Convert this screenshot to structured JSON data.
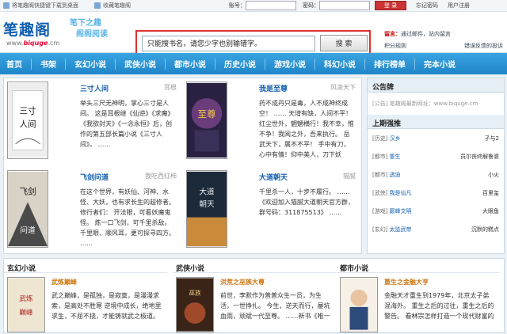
{
  "topbar": {
    "shortcut": "将笔趣阁快捷键下载到桌面",
    "bookmark": "收藏笔趣阁",
    "account_label": "账号：",
    "password_label": "密码：",
    "login_button": "登 录",
    "forgot": "忘记密码",
    "register": "用户注册"
  },
  "logo": {
    "cn": "笔趣阁",
    "en_prefix": "www.",
    "en_main": "biquge",
    "en_suffix": ".cm"
  },
  "slogan": {
    "line1": "笔下之趣",
    "line2": "阁阁阅读"
  },
  "search": {
    "value": "只能搜书名，请您少字也别输错字。",
    "button": "搜 索"
  },
  "notice": {
    "r1_label": "留言：",
    "r1_text": "通过邮件，站内留言",
    "r2_a": "积分规则",
    "r2_b": "错误反馈的投诉"
  },
  "nav": [
    "首页",
    "书架",
    "玄幻小说",
    "武侠小说",
    "都市小说",
    "历史小说",
    "游戏小说",
    "科幻小说",
    "排行榜单",
    "完本小说"
  ],
  "books": [
    {
      "title": "三寸人间",
      "author": "耳根",
      "desc": "举头三尺无神明，掌心三寸是人间。 这是耳根继《仙逆》《求魔》《我欲封天》《一念永恒》后，创作的第五部长篇小说《三寸人间》。 ……"
    },
    {
      "title": "我是至尊",
      "author": "风凌天下",
      "desc": "药不成丹只是毒，人不成神终成空！ …… 天增有缺，人间不平！红尘世外，魍魉横行！我不幸，惟不争！我阅之外，吾来执行。 岳武天下，属不不平！ 手中有刀，心中有情！仰中美人，刀下妖"
    },
    {
      "title": "飞剑问道",
      "author": "我吃西红柿",
      "desc": "在这个世界，有妖仙、河神、水怪、大妖，也有求长生的超修者。 修行者们： 开法眼，可看妖魔鬼怪。 炼一口飞剑，可千里杀敌。 千里眼、顺风耳，更可探寻四方。 ……"
    },
    {
      "title": "大道朝天",
      "author": "猫腻",
      "desc": "千里杀一人，十步不履行。 …… 《欢迎加入猫腻大道朝天官方群，群号码：311875513》 ……"
    }
  ],
  "side": {
    "notice_title": "公告牌",
    "notice_tag": "[公告]",
    "notice_text": "笔趣阁最新网址：www.biquge.cm",
    "rank_title": "上期强推",
    "ranks": [
      {
        "cat": "[历史]",
        "book": "汉乡",
        "author": "孑与2"
      },
      {
        "cat": "[都市]",
        "book": "重生",
        "author": "员尔丧终解鲁婆"
      },
      {
        "cat": "[都市]",
        "book": "透迪",
        "author": "小火"
      },
      {
        "cat": "[武侠]",
        "book": "我是仙凡",
        "author": "百里玺"
      },
      {
        "cat": "[游戏]",
        "book": "巅峰文明",
        "author": "大眼鱼"
      },
      {
        "cat": "[玄幻]",
        "book": "太监武帝",
        "author": "沉默的糕点"
      }
    ]
  },
  "bottom": [
    {
      "heading": "玄幻小说",
      "title": "武炼巅峰",
      "desc": "武之巅峰，是孤独，是寂寞，是漫漫求索，是高处不胜寒 逆境中成长，绝地里求生，不屈不挠，才能铸就武之极道。"
    },
    {
      "heading": "武侠小说",
      "title": "洪荒之巫族大尊",
      "desc": "前世，李默作为普普众生一员，为生活，一世挣扎。 今生，逆天而行，屡坑血雨，顽斌一代至尊。 ……新书《唯一"
    },
    {
      "heading": "都市小说",
      "title": "重生之金融大亨",
      "desc": "金融天才重生到1979年，北京太子弟混海外。 重生之后的过往，重生之后的警告。 看林宗怎样打造一个现代财富的"
    }
  ],
  "colors": {
    "nav": "#1f86c9",
    "logo": "#0f5fb1",
    "search_border": "#d33",
    "link": "#1560b0"
  }
}
